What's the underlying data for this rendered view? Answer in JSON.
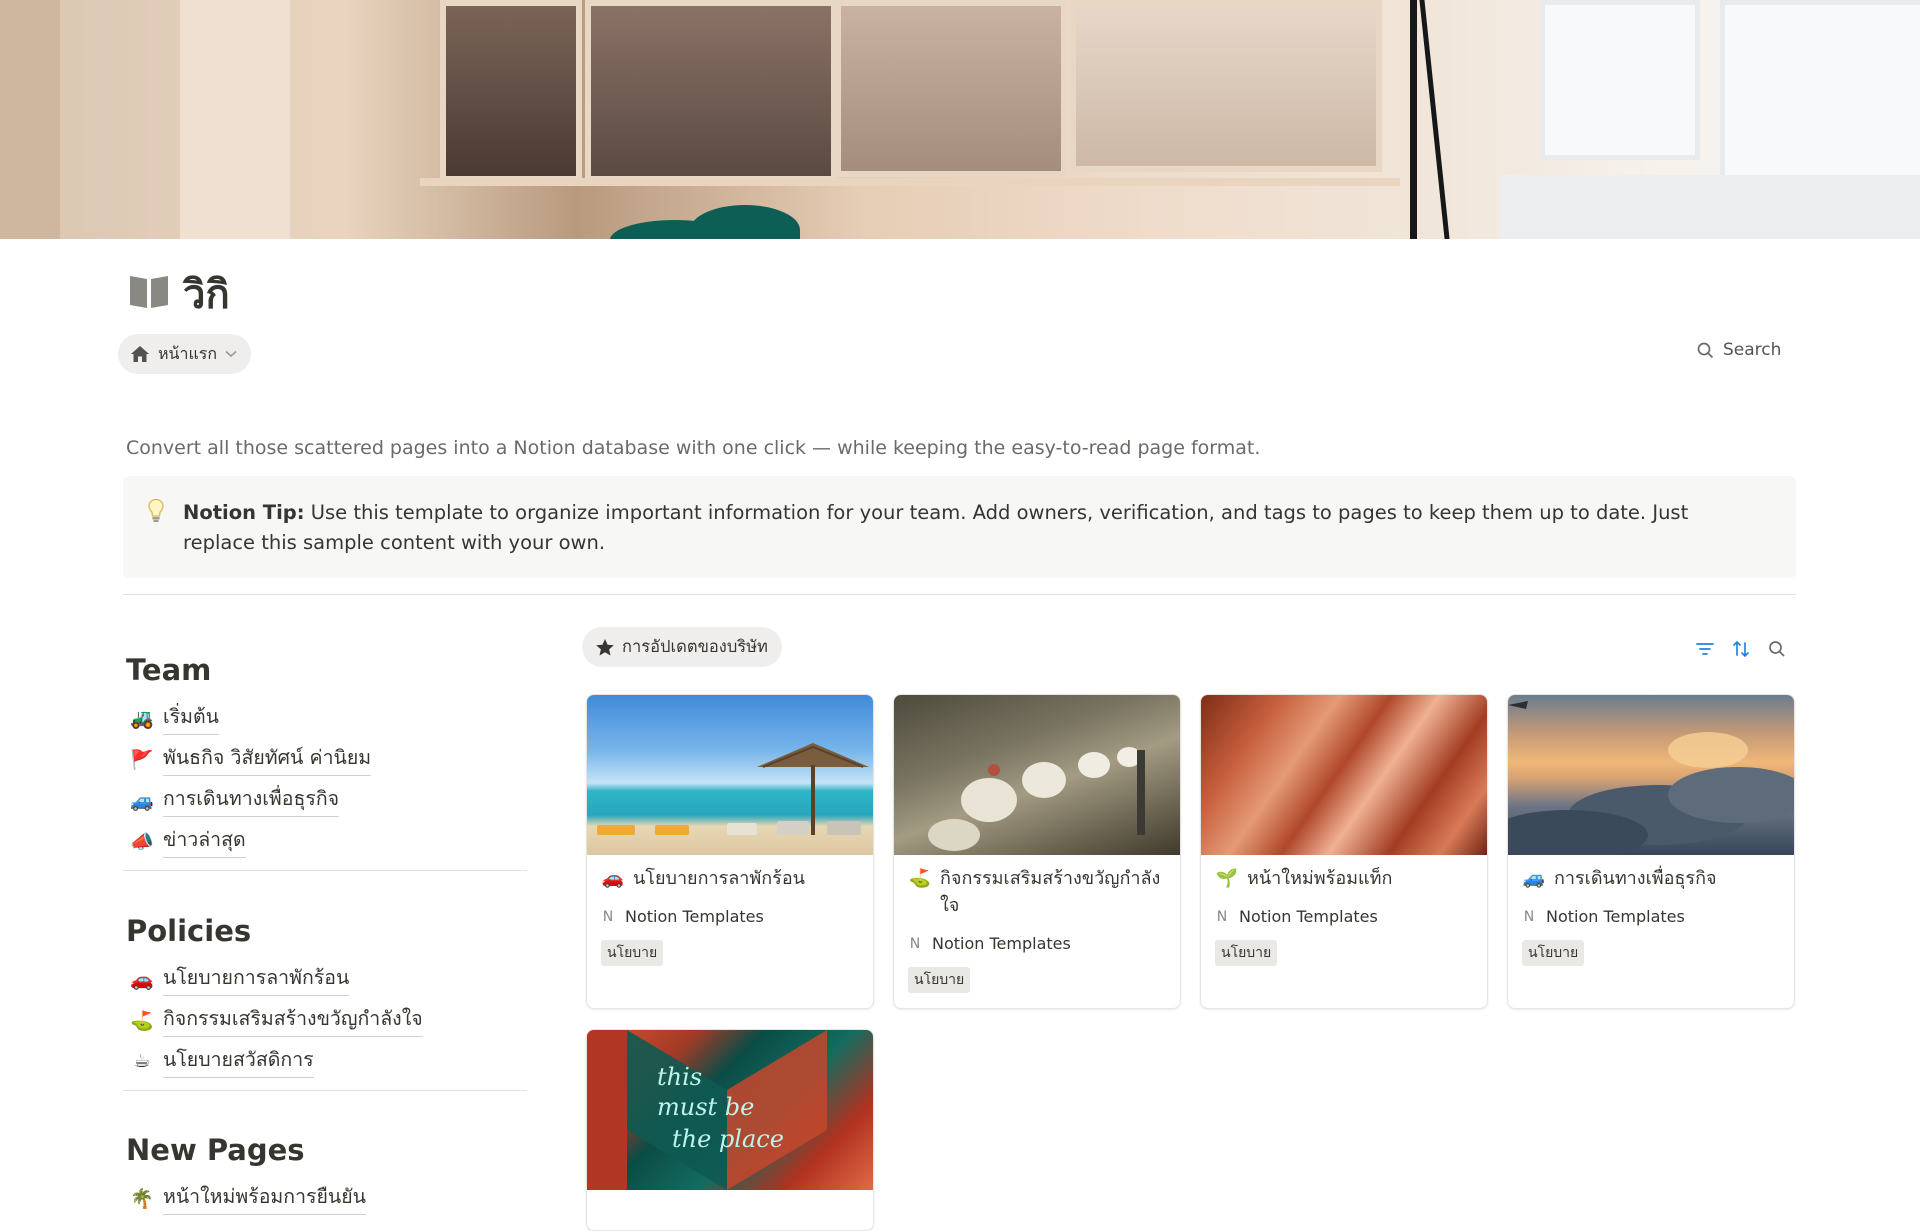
{
  "page": {
    "title": "วิกิ",
    "breadcrumb_label": "หน้าแรก",
    "search_label": "Search",
    "description": "Convert all those scattered pages into a Notion database with one click — while keeping the easy-to-read page format.",
    "callout": {
      "bold": "Notion Tip:",
      "text": " Use this template to organize important information for your team. Add owners, verification, and tags to pages to keep them up to date. Just replace this sample content with your own."
    }
  },
  "sidebar": {
    "team": {
      "title": "Team",
      "items": [
        {
          "emoji": "🚜",
          "label": "เริ่มต้น"
        },
        {
          "emoji": "🚩",
          "label": "พันธกิจ วิสัยทัศน์ ค่านิยม"
        },
        {
          "emoji": "🚙",
          "label": "การเดินทางเพื่อธุรกิจ"
        },
        {
          "emoji": "📣",
          "label": "ข่าวล่าสุด"
        }
      ]
    },
    "policies": {
      "title": "Policies",
      "items": [
        {
          "emoji": "🚗",
          "label": "นโยบายการลาพักร้อน"
        },
        {
          "emoji": "⛳",
          "label": "กิจกรรมเสริมสร้างขวัญกำลังใจ"
        },
        {
          "emoji": "☕",
          "label": "นโยบายสวัสดิการ"
        }
      ]
    },
    "new_pages": {
      "title": "New Pages",
      "items": [
        {
          "emoji": "🌴",
          "label": "หน้าใหม่พร้อมการยืนยัน"
        }
      ]
    }
  },
  "gallery": {
    "view_tab": "การอัปเดตของบริษัท",
    "cards": [
      {
        "emoji": "🚗",
        "title": "นโยบายการลาพักร้อน",
        "source": "Notion Templates",
        "source_icon": "N",
        "tag": "นโยบาย"
      },
      {
        "emoji": "⛳",
        "title": "กิจกรรมเสริมสร้างขวัญกำลังใจ",
        "source": "Notion Templates",
        "source_icon": "N",
        "tag": "นโยบาย"
      },
      {
        "emoji": "🌱",
        "title": "หน้าใหม่พร้อมแท็ก",
        "source": "Notion Templates",
        "source_icon": "N",
        "tag": "นโยบาย"
      },
      {
        "emoji": "🚙",
        "title": "การเดินทางเพื่อธุรกิจ",
        "source": "Notion Templates",
        "source_icon": "N",
        "tag": "นโยบาย"
      }
    ],
    "neon_sign_text": [
      "this",
      "must be",
      "the place"
    ]
  },
  "colors": {
    "text": "#37352f",
    "muted": "#6b6a66",
    "accent_blue": "#2383e2",
    "pill_bg": "#efeeec",
    "callout_bg": "#f7f7f5"
  }
}
